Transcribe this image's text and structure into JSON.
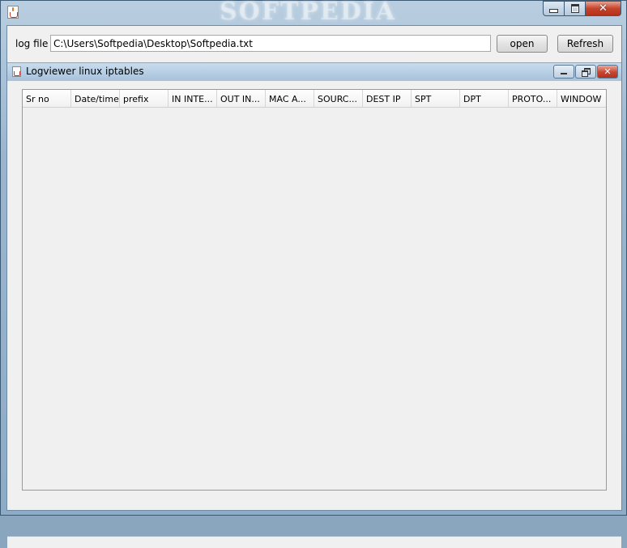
{
  "window": {
    "watermark": "SOFTPEDIA",
    "caption_buttons": {
      "minimize": "minimize",
      "maximize": "maximize",
      "close": "✕"
    }
  },
  "toolbar": {
    "log_file_label": "log file",
    "path_value": "C:\\Users\\Softpedia\\Desktop\\Softpedia.txt",
    "open_label": "open",
    "refresh_label": "Refresh"
  },
  "internal_frame": {
    "title": "Logviewer linux iptables",
    "close_glyph": "✕"
  },
  "table": {
    "columns": [
      "Sr no",
      "Date/time",
      "prefix",
      "IN INTE...",
      "OUT IN...",
      "MAC A...",
      "SOURC...",
      "DEST IP",
      "SPT",
      "DPT",
      "PROTO...",
      "WINDOW"
    ],
    "rows": []
  }
}
